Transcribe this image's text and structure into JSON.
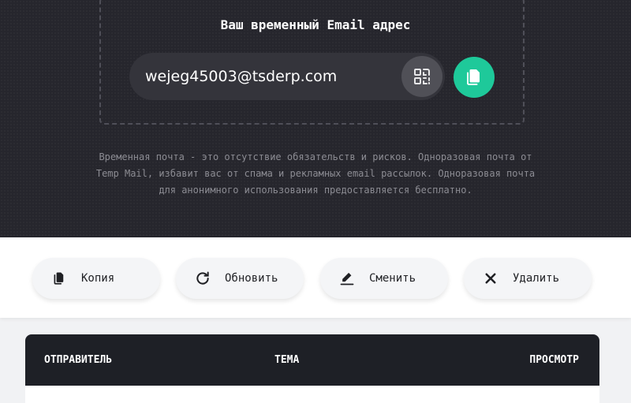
{
  "hero": {
    "title": "Ваш временный Email адрес",
    "email": "wejeg45003@tsderp.com",
    "qr_icon": "qr-code-icon",
    "copy_icon": "copy-icon",
    "description": "Временная почта - это отсутствие обязательств и рисков. Одноразовая почта от Temp Mail, избавит вас от спама и рекламных email рассылок. Одноразовая почта для анонимного использования предоставляется бесплатно."
  },
  "actions": {
    "copy_label": "Копия",
    "refresh_label": "Обновить",
    "change_label": "Сменить",
    "delete_label": "Удалить"
  },
  "inbox": {
    "columns": [
      "ОТПРАВИТЕЛЬ",
      "ТЕМА",
      "ПРОСМОТР"
    ]
  },
  "colors": {
    "hero_bg": "#26262d",
    "accent": "#1ec99a",
    "table_header_bg": "#1e2026"
  }
}
